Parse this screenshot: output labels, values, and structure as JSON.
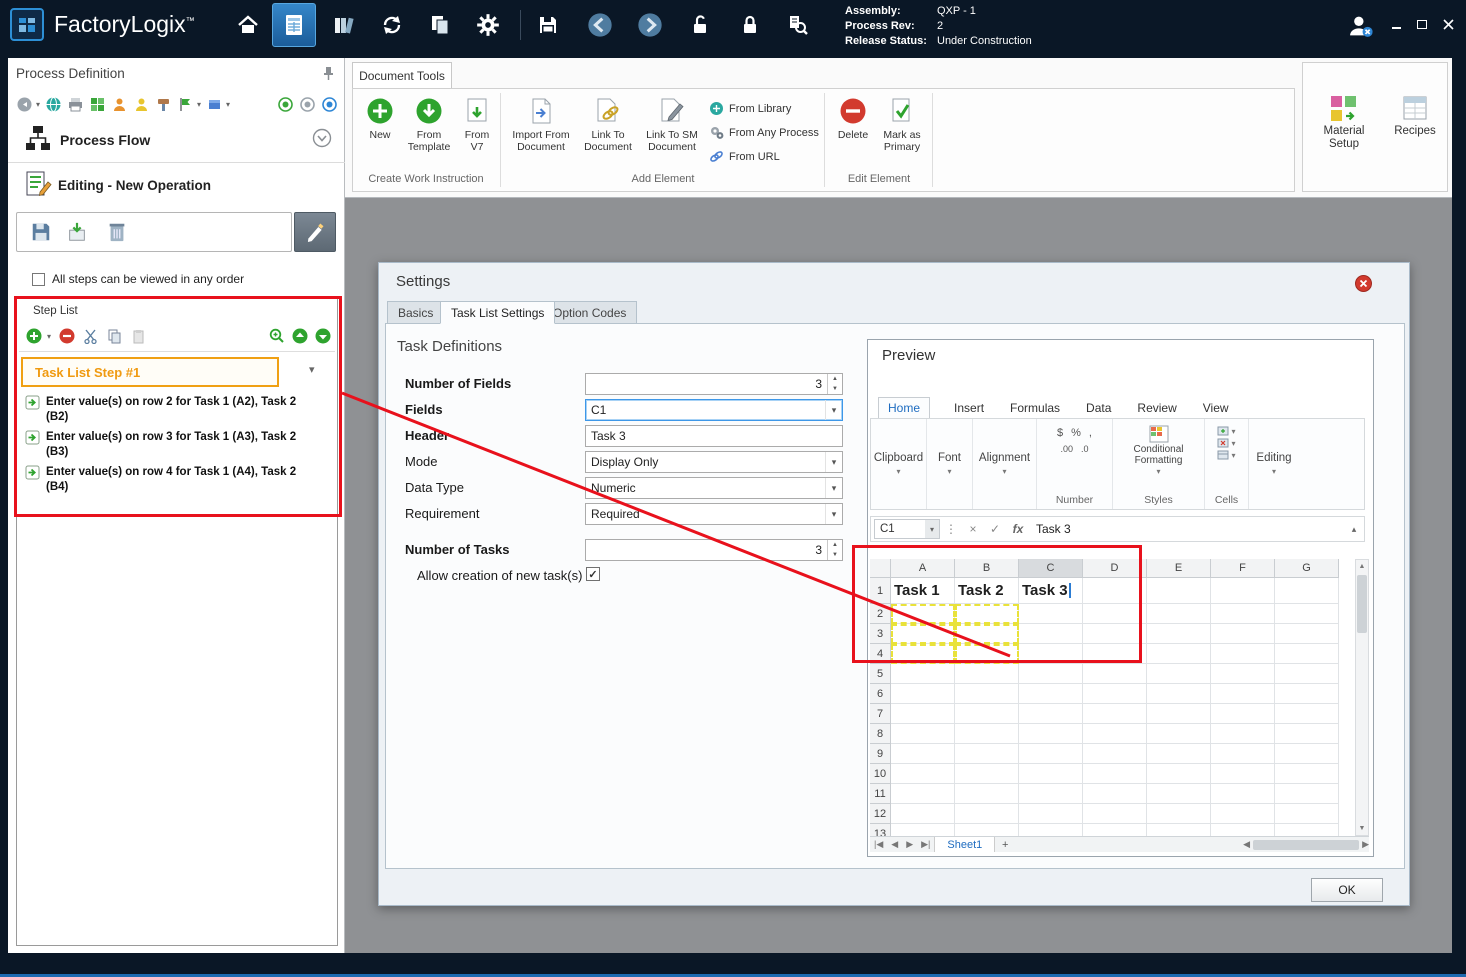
{
  "titlebar": {
    "app_name": "FactoryLogix",
    "trademark": "™",
    "assembly_label": "Assembly:",
    "assembly_value": "QXP - 1",
    "process_rev_label": "Process Rev:",
    "process_rev_value": "2",
    "release_status_label": "Release Status:",
    "release_status_value": "Under Construction"
  },
  "ribbon": {
    "tab_label": "Document Tools",
    "create_group": {
      "label": "Create Work Instruction",
      "new": "New",
      "from_template": "From Template",
      "from_v7": "From V7"
    },
    "add_group": {
      "label": "Add Element",
      "import_from_document": "Import From Document",
      "link_to_document": "Link To Document",
      "link_to_sm_document": "Link To SM Document",
      "from_library": "From Library",
      "from_any_process": "From Any Process",
      "from_url": "From URL"
    },
    "edit_group": {
      "label": "Edit Element",
      "delete": "Delete",
      "mark_as_primary": "Mark as Primary"
    },
    "material_setup": "Material Setup",
    "recipes": "Recipes"
  },
  "left_panel": {
    "title": "Process Definition",
    "process_flow_label": "Process Flow",
    "editing_label": "Editing - New Operation",
    "order_checkbox_label": "All steps can be viewed in any order",
    "step_list": {
      "title": "Step List",
      "selected_step": "Task List Step #1",
      "items": [
        "Enter value(s) on row 2 for Task 1 (A2), Task 2 (B2)",
        "Enter value(s) on row 3 for Task 1 (A3), Task 2 (B3)",
        "Enter value(s) on row 4 for Task 1 (A4), Task 2 (B4)"
      ]
    }
  },
  "settings": {
    "title": "Settings",
    "tabs": [
      "Basics",
      "Task List Settings",
      "Option Codes"
    ],
    "active_tab": "Task List Settings",
    "section_title": "Task Definitions",
    "fields_form": {
      "number_of_fields_label": "Number of Fields",
      "number_of_fields_value": "3",
      "fields_label": "Fields",
      "fields_value": "C1",
      "header_label": "Header",
      "header_value": "Task 3",
      "mode_label": "Mode",
      "mode_value": "Display Only",
      "data_type_label": "Data Type",
      "data_type_value": "Numeric",
      "requirement_label": "Requirement",
      "requirement_value": "Required",
      "number_of_tasks_label": "Number of Tasks",
      "number_of_tasks_value": "3",
      "allow_new_tasks_label": "Allow creation of new task(s)"
    },
    "ok_label": "OK"
  },
  "preview": {
    "title": "Preview",
    "tabs": [
      "Home",
      "Insert",
      "Formulas",
      "Data",
      "Review",
      "View"
    ],
    "active_tab": "Home",
    "groups": {
      "clipboard": "Clipboard",
      "font": "Font",
      "alignment": "Alignment",
      "number": "Number",
      "conditional_formatting": "Conditional Formatting",
      "styles": "Styles",
      "cells": "Cells",
      "editing": "Editing"
    },
    "formula_bar": {
      "cell_ref": "C1",
      "fx_label": "fx",
      "value": "Task 3"
    },
    "grid": {
      "columns": [
        "A",
        "B",
        "C",
        "D",
        "E",
        "F",
        "G"
      ],
      "row_count": 13,
      "selected_column": "C",
      "editing_cell": "C1",
      "cells": {
        "A1": "Task 1",
        "B1": "Task 2",
        "C1": "Task 3"
      },
      "dashed_cells": [
        "A2",
        "B2",
        "A3",
        "B3",
        "A4",
        "B4"
      ]
    },
    "sheet_tab": "Sheet1",
    "add_sheet_label": "+"
  },
  "icons": {
    "chevron_down": "▾",
    "chevron_up": "▴",
    "arrow_up": "▲",
    "arrow_down": "▼",
    "arrow_left": "◀",
    "arrow_right": "▶",
    "nav_first": "|◀",
    "nav_prev": "◀",
    "nav_next": "▶",
    "nav_last": "▶|",
    "dots": "⋮",
    "cancel": "×",
    "check": "✓",
    "percent": "%",
    "dollar": "$",
    "comma": ",",
    "decimal_inc": ".00",
    "decimal_dec": ".0"
  }
}
